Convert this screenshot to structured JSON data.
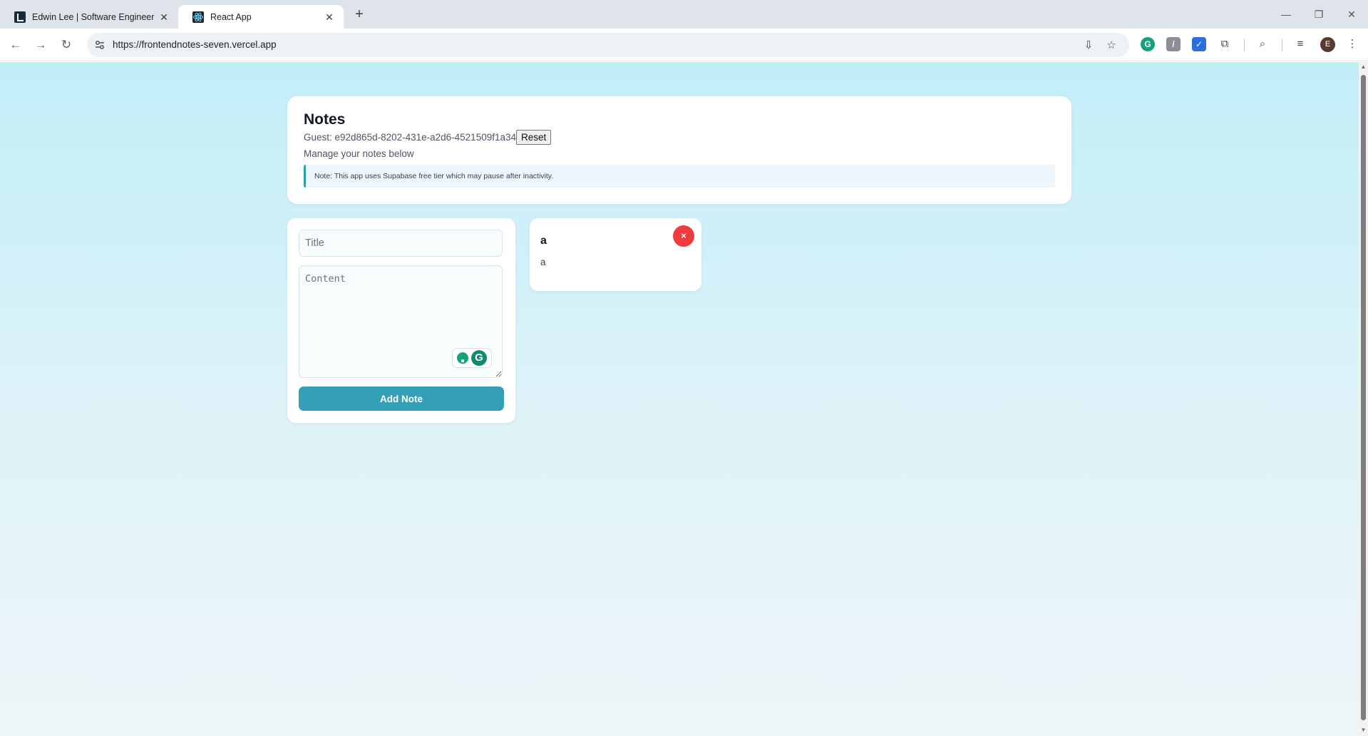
{
  "browser": {
    "tabs": [
      {
        "title": "Edwin Lee | Software Engineer",
        "active": false
      },
      {
        "title": "React App",
        "active": true
      }
    ],
    "url": "https://frontendnotes-seven.vercel.app",
    "profile_initial": "E"
  },
  "header": {
    "title": "Notes",
    "guest_label": "Guest: e92d865d-8202-431e-a2d6-4521509f1a34",
    "reset_label": "Reset",
    "subtitle": "Manage your notes below",
    "notice": "Note: This app uses Supabase free tier which may pause after inactivity."
  },
  "form": {
    "title_placeholder": "Title",
    "content_placeholder": "Content",
    "add_label": "Add Note"
  },
  "notes": [
    {
      "title": "a",
      "content": "a",
      "delete_label": "×"
    }
  ],
  "colors": {
    "accent": "#34a0b6",
    "delete": "#ef3b3b",
    "background_top": "#c2eef8",
    "background_bottom": "#edf5f8"
  }
}
